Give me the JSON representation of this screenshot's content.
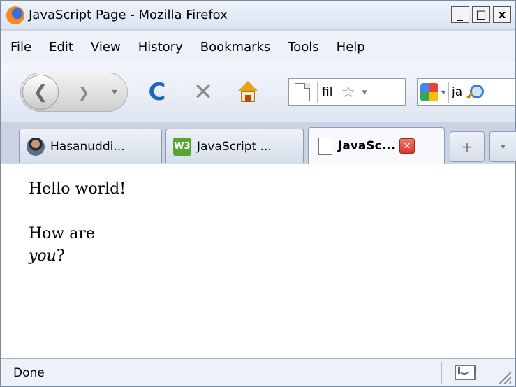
{
  "window": {
    "title": "JavaScript Page - Mozilla Firefox",
    "controls": {
      "minimize": "_",
      "maximize": "□",
      "close": "x"
    }
  },
  "menubar": {
    "items": [
      {
        "label": "File"
      },
      {
        "label": "Edit"
      },
      {
        "label": "View"
      },
      {
        "label": "History"
      },
      {
        "label": "Bookmarks"
      },
      {
        "label": "Tools"
      },
      {
        "label": "Help"
      }
    ]
  },
  "toolbar": {
    "url_value": "fil",
    "search_value": "ja"
  },
  "tabs": [
    {
      "label": "Hasanuddi...",
      "favicon": "avatar-icon"
    },
    {
      "label": "JavaScript ...",
      "favicon": "w3c-icon",
      "favicon_text": "W3"
    },
    {
      "label": "JavaSc...",
      "favicon": "page-icon",
      "active": true
    }
  ],
  "content": {
    "line1": "Hello world!",
    "line2": "How are",
    "line3_italic": "you",
    "line3_suffix": "?"
  },
  "statusbar": {
    "text": "Done"
  },
  "colors": {
    "chrome_bg": "#d4dbe8",
    "reload_blue": "#1c66c6",
    "tab_close_red": "#d7382b"
  }
}
